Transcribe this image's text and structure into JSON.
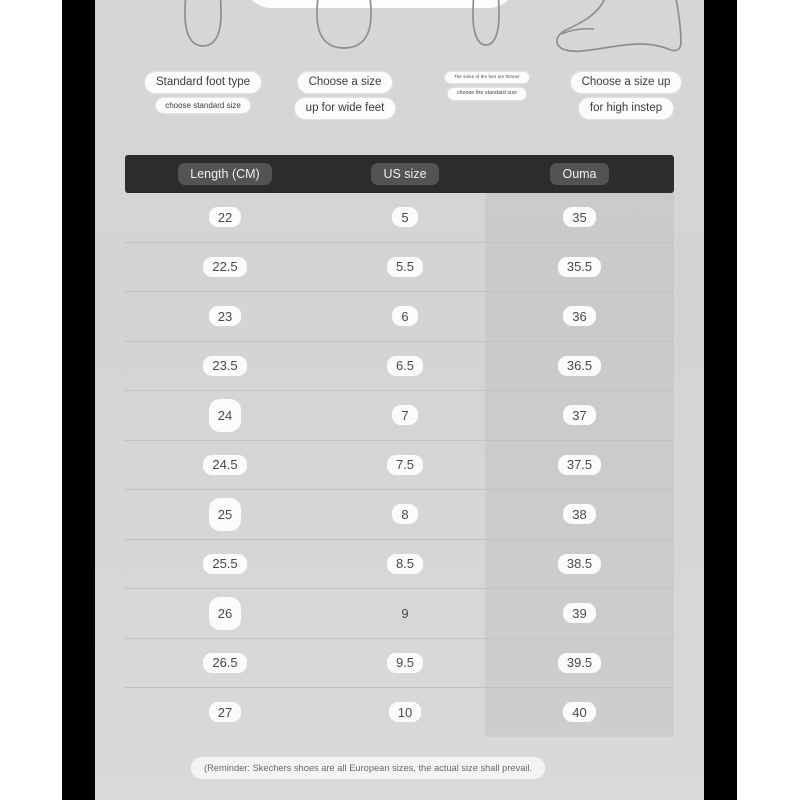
{
  "panel": {
    "background_color": "#d5d5d7",
    "sidebar_color": "#000000"
  },
  "foot_guides": [
    {
      "icon": "foot-outline-standard",
      "line1": "Standard foot type",
      "line2": "choose standard size",
      "size_class": "lg"
    },
    {
      "icon": "foot-outline-wide",
      "line1": "Choose a size",
      "line2": "up for wide feet",
      "size_class": "lg"
    },
    {
      "icon": "foot-outline-thin",
      "line1": "The soles of the feet are thinner",
      "line2": "choose the standard size",
      "size_class": "xs"
    },
    {
      "icon": "foot-profile-high-instep",
      "line1": "Choose a size up",
      "line2": "for high instep",
      "size_class": "lg"
    }
  ],
  "table": {
    "header_background": "#2c2c2e",
    "header_pill_background": "#535356",
    "columns": [
      "Length (CM)",
      "US size",
      "Ouma"
    ],
    "rows": [
      [
        "22",
        "5",
        "35"
      ],
      [
        "22.5",
        "5.5",
        "35.5"
      ],
      [
        "23",
        "6",
        "36"
      ],
      [
        "23.5",
        "6.5",
        "36.5"
      ],
      [
        "24",
        "7",
        "37"
      ],
      [
        "24.5",
        "7.5",
        "37.5"
      ],
      [
        "25",
        "8",
        "38"
      ],
      [
        "25.5",
        "8.5",
        "38.5"
      ],
      [
        "26",
        "9",
        "39"
      ],
      [
        "26.5",
        "9.5",
        "39.5"
      ],
      [
        "27",
        "10",
        "40"
      ]
    ],
    "highlight_cells": [
      "4:0",
      "6:0",
      "8:0"
    ],
    "bare_cells": [
      "8:1"
    ]
  },
  "footer": {
    "reminder": "(Reminder: Skechers shoes are all European sizes, the actual size shall prevail."
  }
}
